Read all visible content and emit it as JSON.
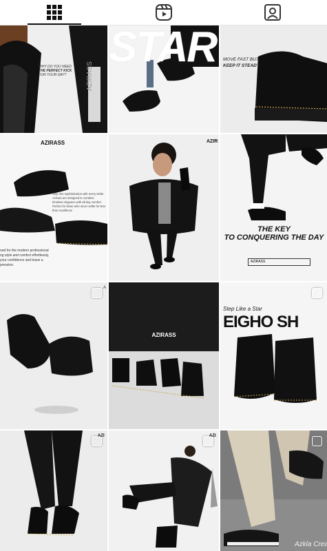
{
  "tabs": [
    {
      "name": "grid-icon",
      "active": true
    },
    {
      "name": "reels-icon",
      "active": false
    },
    {
      "name": "tagged-icon",
      "active": false
    }
  ],
  "posts": {
    "p1": {
      "lines": [
        "WHY DO YOU NEED",
        "THE PERFECT KICK",
        "FOR YOUR DAY?"
      ],
      "brand": "AZIRASS"
    },
    "p2": {
      "headline": "STAR"
    },
    "p3": {
      "lines": [
        "MOVE FAST BUT",
        "KEEP IT STEADY"
      ]
    },
    "p4": {
      "brand": "AZIRASS",
      "body": [
        "Step into sophistication with every stride.",
        "Azirass are designed to combine",
        "timeless elegance with all-day comfort.",
        "Perfect for those who never settle for less",
        "than excellence"
      ],
      "footer": [
        "ned for the modern professional",
        "ng style and comfort effortlessly,",
        "your confidence and leave a",
        "pression."
      ]
    },
    "p5": {
      "brand": "AZIR"
    },
    "p6": {
      "headline": [
        "THE KEY",
        "TO CONQUERING THE DAY"
      ],
      "brand": "AZIRASS"
    },
    "p7": {
      "brand": "A"
    },
    "p8": {
      "brand": "AZIRASS"
    },
    "p9": {
      "lines": [
        "Step Like a Star",
        "EIGHO SH"
      ]
    },
    "p10": {
      "brand": "AZI"
    },
    "p11": {
      "brand": "AZI"
    },
    "p12": {
      "signature": "Azkla Cream"
    }
  }
}
